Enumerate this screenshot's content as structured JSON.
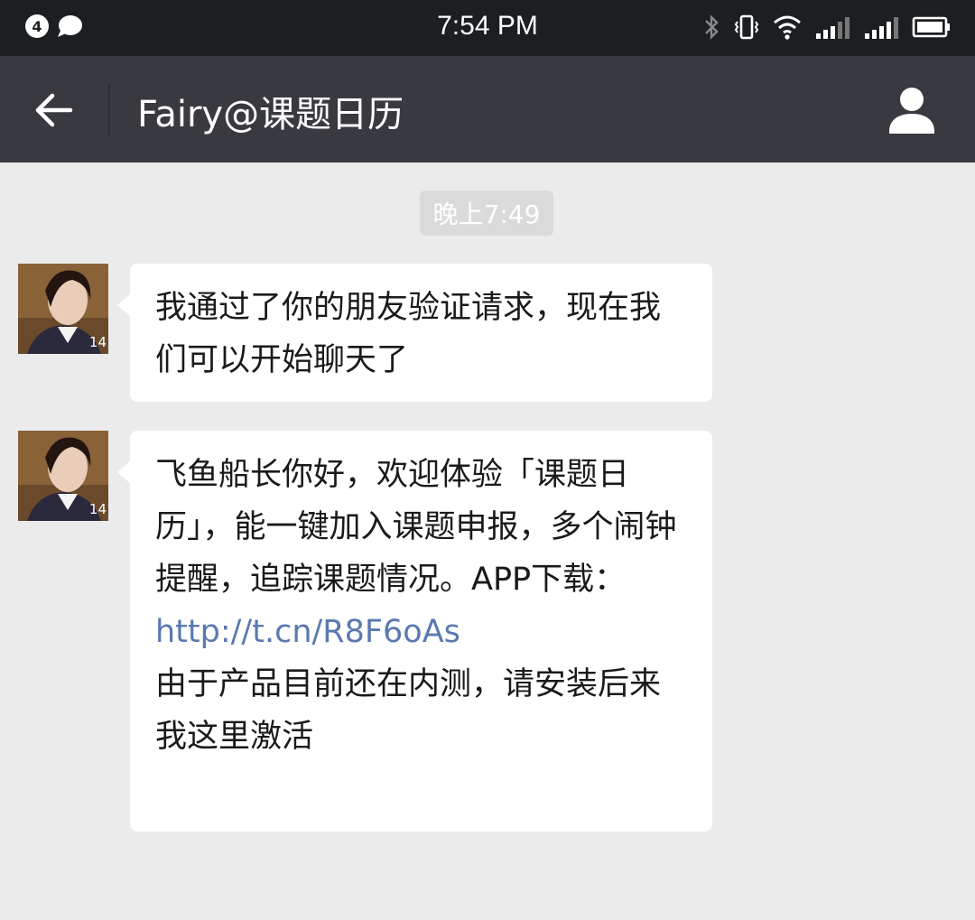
{
  "status_bar": {
    "notification_count": "4",
    "time": "7:54 PM",
    "icons": [
      "bluetooth-icon",
      "vibrate-icon",
      "wifi-icon",
      "signal-icon",
      "signal-2-icon",
      "battery-icon"
    ]
  },
  "nav": {
    "title": "Fairy@课题日历",
    "back_icon": "arrow-left-icon",
    "profile_icon": "user-icon"
  },
  "chat": {
    "timestamp": "晚上7:49",
    "avatar_badge": "14",
    "messages": [
      {
        "lines": [
          "我通过了你的朋友验证请求，现在我们可以开始聊天了"
        ]
      },
      {
        "text_before_link": "飞鱼船长你好，欢迎体验「课题日历」，能一键加入课题申报，多个闹钟提醒，追踪课题情况。APP下载：",
        "link": "http://t.cn/R8F6oAs",
        "text_after_link": "由于产品目前还在内测，请安装后来我这里激活"
      }
    ]
  },
  "colors": {
    "status_bar_bg": "#1c1f21",
    "nav_bg": "#393a3f",
    "chat_bg": "#ebebeb",
    "bubble_bg": "#ffffff",
    "link": "#5a79b0"
  }
}
